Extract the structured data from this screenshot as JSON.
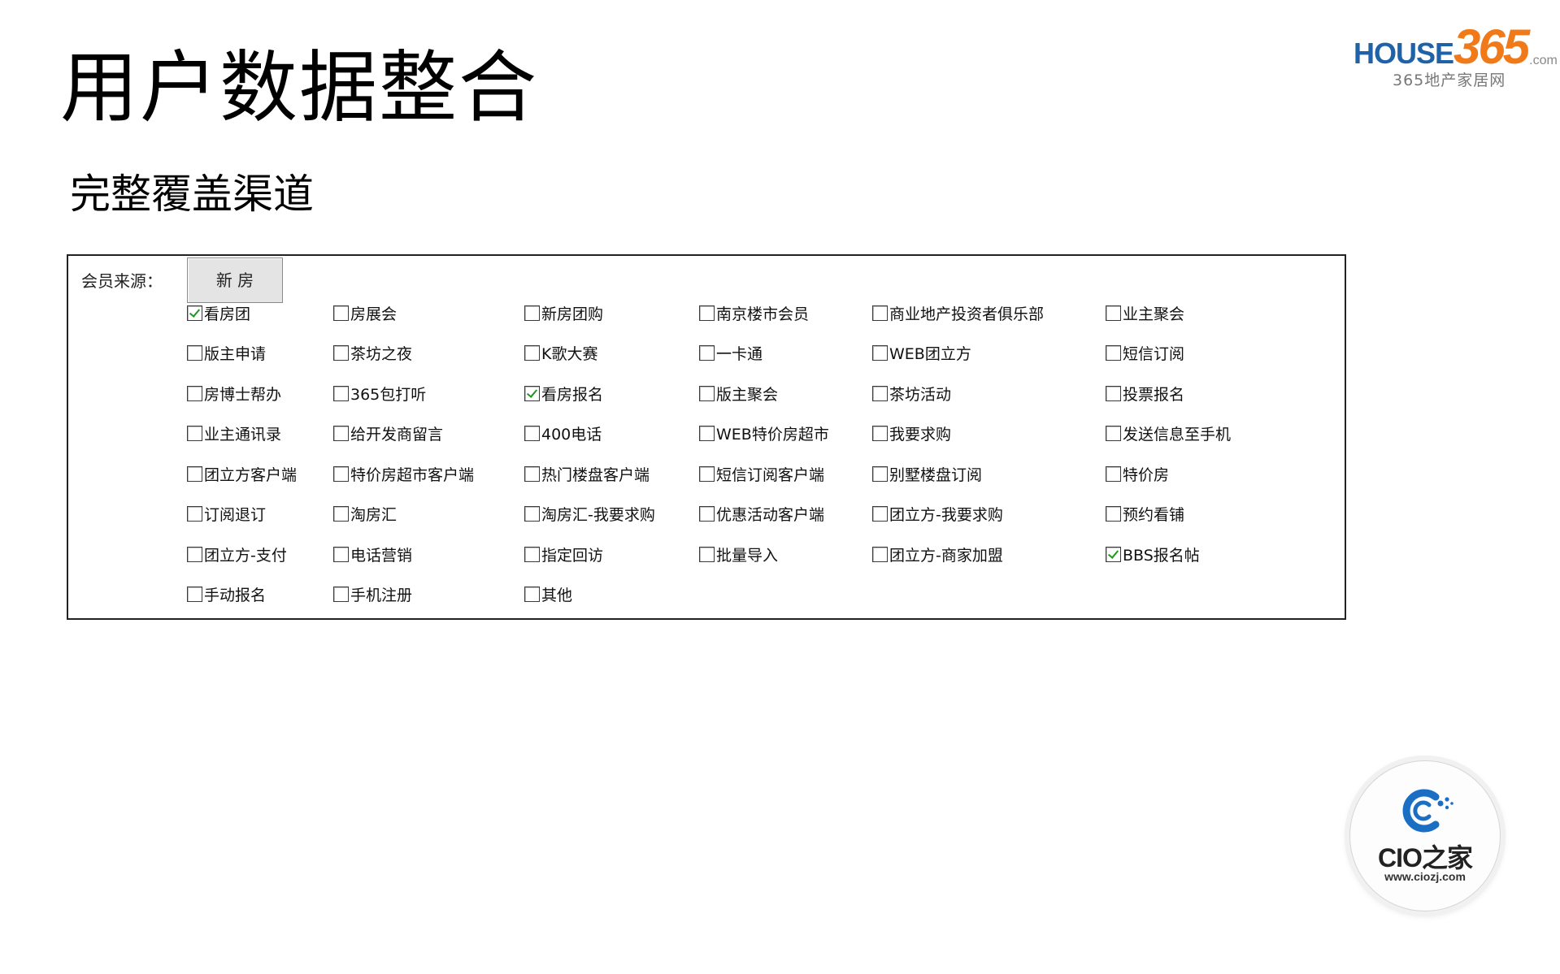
{
  "title": "用户数据整合",
  "subtitle": "完整覆盖渠道",
  "brand_logo": {
    "word": "HOUSE",
    "number": "365",
    "suffix": ".com",
    "tagline": "365地产家居网",
    "colors": {
      "word": "#1f62a8",
      "number": "#f07a1a"
    }
  },
  "panel": {
    "source_label": "会员来源：",
    "tab_label": "新 房",
    "checkboxes": [
      {
        "label": "看房团",
        "checked": true
      },
      {
        "label": "房展会",
        "checked": false
      },
      {
        "label": "新房团购",
        "checked": false
      },
      {
        "label": "南京楼市会员",
        "checked": false
      },
      {
        "label": "商业地产投资者俱乐部",
        "checked": false
      },
      {
        "label": "业主聚会",
        "checked": false
      },
      {
        "label": "版主申请",
        "checked": false
      },
      {
        "label": "茶坊之夜",
        "checked": false
      },
      {
        "label": "K歌大赛",
        "checked": false
      },
      {
        "label": "一卡通",
        "checked": false
      },
      {
        "label": "WEB团立方",
        "checked": false
      },
      {
        "label": "短信订阅",
        "checked": false
      },
      {
        "label": "房博士帮办",
        "checked": false
      },
      {
        "label": "365包打听",
        "checked": false
      },
      {
        "label": "看房报名",
        "checked": true
      },
      {
        "label": "版主聚会",
        "checked": false
      },
      {
        "label": "茶坊活动",
        "checked": false
      },
      {
        "label": "投票报名",
        "checked": false
      },
      {
        "label": "业主通讯录",
        "checked": false
      },
      {
        "label": "给开发商留言",
        "checked": false
      },
      {
        "label": "400电话",
        "checked": false
      },
      {
        "label": "WEB特价房超市",
        "checked": false
      },
      {
        "label": "我要求购",
        "checked": false
      },
      {
        "label": "发送信息至手机",
        "checked": false
      },
      {
        "label": "团立方客户端",
        "checked": false
      },
      {
        "label": "特价房超市客户端",
        "checked": false
      },
      {
        "label": "热门楼盘客户端",
        "checked": false
      },
      {
        "label": "短信订阅客户端",
        "checked": false
      },
      {
        "label": "别墅楼盘订阅",
        "checked": false
      },
      {
        "label": "特价房",
        "checked": false
      },
      {
        "label": "订阅退订",
        "checked": false
      },
      {
        "label": "淘房汇",
        "checked": false
      },
      {
        "label": "淘房汇-我要求购",
        "checked": false
      },
      {
        "label": "优惠活动客户端",
        "checked": false
      },
      {
        "label": "团立方-我要求购",
        "checked": false
      },
      {
        "label": "预约看铺",
        "checked": false
      },
      {
        "label": "团立方-支付",
        "checked": false
      },
      {
        "label": "电话营销",
        "checked": false
      },
      {
        "label": "指定回访",
        "checked": false
      },
      {
        "label": "批量导入",
        "checked": false
      },
      {
        "label": "团立方-商家加盟",
        "checked": false
      },
      {
        "label": "BBS报名帖",
        "checked": true
      },
      {
        "label": "手动报名",
        "checked": false
      },
      {
        "label": "手机注册",
        "checked": false
      },
      {
        "label": "其他",
        "checked": false
      }
    ]
  },
  "cio_logo": {
    "name": "CIO之家",
    "url": "www.ciozj.com",
    "accent": "#1a6fc4"
  }
}
